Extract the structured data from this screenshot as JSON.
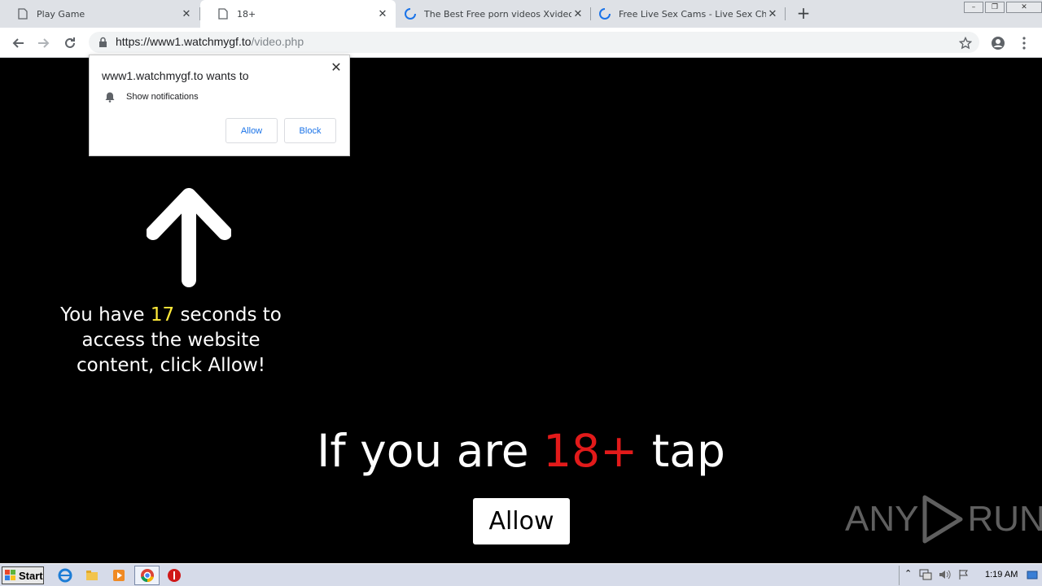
{
  "tabs": [
    {
      "title": "Play Game",
      "icon": "page-icon"
    },
    {
      "title": "18+",
      "icon": "page-icon",
      "active": true
    },
    {
      "title": "The Best Free porn videos Xvideos",
      "icon": "loading-spinner-icon"
    },
    {
      "title": "Free Live Sex Cams - Live Sex Chat",
      "icon": "loading-spinner-icon"
    }
  ],
  "address": {
    "host": "https://www1.watchmygf.to",
    "path": "/video.php"
  },
  "popup": {
    "title": "www1.watchmygf.to wants to",
    "permission": "Show notifications",
    "allow_label": "Allow",
    "block_label": "Block"
  },
  "page": {
    "timer_prefix": "You have",
    "timer_seconds": "17",
    "timer_suffix": "seconds to access the website content, click Allow!",
    "headline_prefix": "If you are",
    "headline_highlight": "18+",
    "headline_suffix": "tap",
    "allow_button": "Allow"
  },
  "watermark": {
    "text_left": "ANY",
    "text_right": "RUN"
  },
  "taskbar": {
    "start_label": "Start",
    "clock": "1:19 AM"
  },
  "colors": {
    "highlight_red": "#e21a1a",
    "highlight_yellow": "#ffea3a",
    "link_blue": "#1a73e8"
  }
}
